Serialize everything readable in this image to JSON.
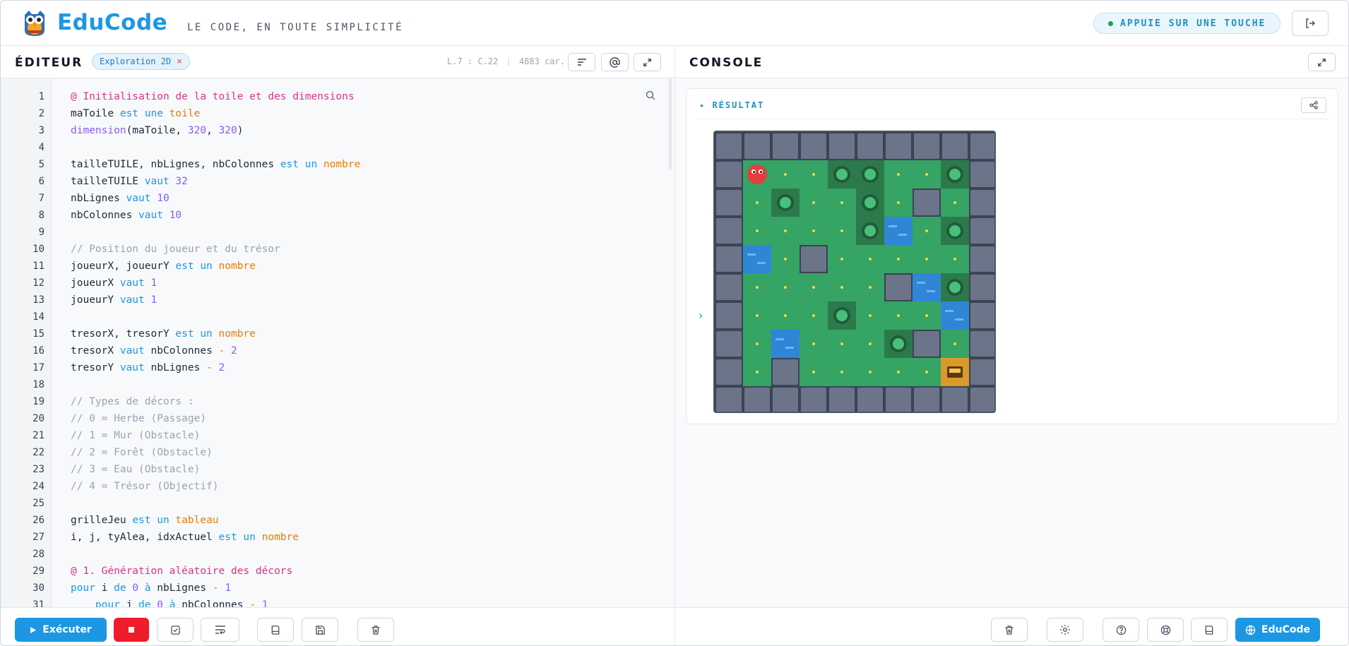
{
  "header": {
    "brand": "EduCode",
    "tagline": "LE CODE, EN TOUTE SIMPLICITÉ",
    "key_badge": "APPUIE SUR UNE TOUCHE"
  },
  "editor": {
    "title": "ÉDITEUR",
    "tab_label": "Exploration 2D",
    "tab_close": "×",
    "position": "L.7 : C.22",
    "separator": "|",
    "char_count": "4883 car.",
    "lines": [
      [
        [
          "@ Initialisation de la toile et des dimensions",
          "pink"
        ]
      ],
      [
        [
          "maToile ",
          ""
        ],
        [
          "est une ",
          "kw"
        ],
        [
          "toile",
          "type"
        ]
      ],
      [
        [
          "dimension",
          "fn"
        ],
        [
          "(maToile, ",
          ""
        ],
        [
          "320",
          "num"
        ],
        [
          ", ",
          ""
        ],
        [
          "320",
          "num"
        ],
        [
          ")",
          ""
        ]
      ],
      [],
      [
        [
          "tailleTUILE, nbLignes, nbColonnes ",
          ""
        ],
        [
          "est un ",
          "kw"
        ],
        [
          "nombre",
          "type"
        ]
      ],
      [
        [
          "tailleTUILE ",
          ""
        ],
        [
          "vaut ",
          "kw"
        ],
        [
          "32",
          "num"
        ]
      ],
      [
        [
          "nbLignes ",
          ""
        ],
        [
          "vaut ",
          "kw"
        ],
        [
          "10",
          "num"
        ]
      ],
      [
        [
          "nbColonnes ",
          ""
        ],
        [
          "vaut ",
          "kw"
        ],
        [
          "10",
          "num"
        ]
      ],
      [],
      [
        [
          "// Position du joueur et du trésor",
          "cm"
        ]
      ],
      [
        [
          "joueurX, joueurY ",
          ""
        ],
        [
          "est un ",
          "kw"
        ],
        [
          "nombre",
          "type"
        ]
      ],
      [
        [
          "joueurX ",
          ""
        ],
        [
          "vaut ",
          "kw"
        ],
        [
          "1",
          "num"
        ]
      ],
      [
        [
          "joueurY ",
          ""
        ],
        [
          "vaut ",
          "kw"
        ],
        [
          "1",
          "num"
        ]
      ],
      [],
      [
        [
          "tresorX, tresorY ",
          ""
        ],
        [
          "est un ",
          "kw"
        ],
        [
          "nombre",
          "type"
        ]
      ],
      [
        [
          "tresorX ",
          ""
        ],
        [
          "vaut ",
          "kw"
        ],
        [
          "nbColonnes ",
          ""
        ],
        [
          "- ",
          "op"
        ],
        [
          "2",
          "num"
        ]
      ],
      [
        [
          "tresorY ",
          ""
        ],
        [
          "vaut ",
          "kw"
        ],
        [
          "nbLignes ",
          ""
        ],
        [
          "- ",
          "op"
        ],
        [
          "2",
          "num"
        ]
      ],
      [],
      [
        [
          "// Types de décors :",
          "cm"
        ]
      ],
      [
        [
          "// 0 = Herbe (Passage)",
          "cm"
        ]
      ],
      [
        [
          "// 1 = Mur (Obstacle)",
          "cm"
        ]
      ],
      [
        [
          "// 2 = Forêt (Obstacle)",
          "cm"
        ]
      ],
      [
        [
          "// 3 = Eau (Obstacle)",
          "cm"
        ]
      ],
      [
        [
          "// 4 = Trésor (Objectif)",
          "cm"
        ]
      ],
      [],
      [
        [
          "grilleJeu ",
          ""
        ],
        [
          "est un ",
          "kw"
        ],
        [
          "tableau",
          "type"
        ]
      ],
      [
        [
          "i, j, tyAlea, idxActuel ",
          ""
        ],
        [
          "est un ",
          "kw"
        ],
        [
          "nombre",
          "type"
        ]
      ],
      [],
      [
        [
          "@ 1. Génération aléatoire des décors",
          "pink"
        ]
      ],
      [
        [
          "pour ",
          "kw"
        ],
        [
          "i ",
          ""
        ],
        [
          "de ",
          "kw"
        ],
        [
          "0 ",
          "num"
        ],
        [
          "à ",
          "kw"
        ],
        [
          "nbLignes ",
          ""
        ],
        [
          "- ",
          "op"
        ],
        [
          "1",
          "num"
        ]
      ],
      [
        [
          "    pour ",
          "kw"
        ],
        [
          "j ",
          ""
        ],
        [
          "de ",
          "kw"
        ],
        [
          "0 ",
          "num"
        ],
        [
          "à ",
          "kw"
        ],
        [
          "nbColonnes ",
          ""
        ],
        [
          "- ",
          "op"
        ],
        [
          "1",
          "num"
        ]
      ]
    ]
  },
  "footer_left": {
    "run_label": "Exécuter"
  },
  "console": {
    "title": "CONSOLE",
    "result_label": "✦ RÉSULTAT",
    "prompt_chevron": "›",
    "grid": [
      [
        1,
        1,
        1,
        1,
        1,
        1,
        1,
        1,
        1,
        1
      ],
      [
        1,
        0,
        0,
        0,
        2,
        2,
        0,
        0,
        2,
        1
      ],
      [
        1,
        0,
        2,
        0,
        0,
        2,
        0,
        1,
        0,
        1
      ],
      [
        1,
        0,
        0,
        0,
        0,
        2,
        3,
        0,
        2,
        1
      ],
      [
        1,
        3,
        0,
        1,
        0,
        0,
        0,
        0,
        0,
        1
      ],
      [
        1,
        0,
        0,
        0,
        0,
        0,
        1,
        3,
        2,
        1
      ],
      [
        1,
        0,
        0,
        0,
        2,
        0,
        0,
        0,
        3,
        1
      ],
      [
        1,
        0,
        3,
        0,
        0,
        0,
        2,
        1,
        0,
        1
      ],
      [
        1,
        0,
        1,
        0,
        0,
        0,
        0,
        0,
        4,
        1
      ],
      [
        1,
        1,
        1,
        1,
        1,
        1,
        1,
        1,
        1,
        1
      ]
    ],
    "player": {
      "col": 1,
      "row": 1
    },
    "colors": {
      "grass": "#35a465",
      "wall": "#6b7489",
      "forest": "#2c7a4b",
      "water": "#2f86d6",
      "treasure": "#d99a2b",
      "player": "#e53e3e"
    }
  },
  "footer_right": {
    "educode_label": "EduCode"
  },
  "icons": [
    "owl-logo-icon",
    "logout-icon",
    "format-icon",
    "at-icon",
    "expand-icon",
    "search-icon",
    "play-icon",
    "stop-icon",
    "check-icon",
    "wrap-icon",
    "book-icon",
    "save-icon",
    "trash-icon",
    "settings-icon",
    "help-icon",
    "lifebuoy-icon",
    "globe-icon",
    "share-icon"
  ]
}
